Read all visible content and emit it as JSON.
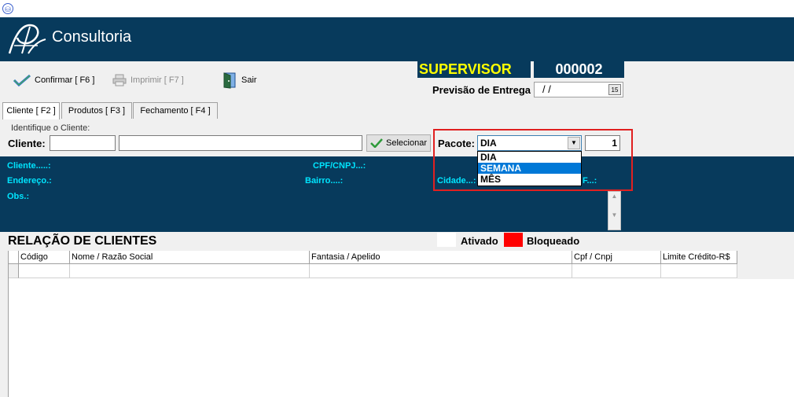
{
  "brand": {
    "name": "Consultoria"
  },
  "toolbar": {
    "confirm_label": "Confirmar [ F6 ]",
    "print_label": "Imprimir  [ F7 ]",
    "exit_label": "Sair"
  },
  "header_info": {
    "role": "SUPERVISOR",
    "code": "000002",
    "delivery_label": "Previsão de Entrega",
    "delivery_value": " /  /"
  },
  "tabs": [
    {
      "label": "Cliente [ F2 ]",
      "active": true
    },
    {
      "label": "Produtos [ F3 ]",
      "active": false
    },
    {
      "label": "Fechamento [ F4 ]",
      "active": false
    }
  ],
  "client_form": {
    "group_label": "Identifique o Cliente:",
    "client_label": "Cliente:",
    "code_value": "",
    "name_value": "",
    "select_button": "Selecionar"
  },
  "pacote": {
    "label": "Pacote:",
    "selected": "DIA",
    "options": [
      "DIA",
      "SEMANA",
      "MÊS"
    ],
    "highlighted_option": "SEMANA",
    "quantity": "1"
  },
  "info_panel": {
    "cliente_label": "Cliente.....:",
    "cpf_label": "CPF/CNPJ...:",
    "endereco_label": "Endereço.:",
    "bairro_label": "Bairro....:",
    "cidade_label": "Cidade...:",
    "uf_label": "F...:",
    "obs_label": "Obs.:"
  },
  "client_list": {
    "title": "RELAÇÃO DE CLIENTES",
    "legend_active": "Ativado",
    "legend_blocked": "Bloqueado",
    "columns": [
      "Código",
      "Nome / Razão Social",
      "Fantasia / Apelido",
      "Cpf / Cnpj",
      "Limite Crédito-R$"
    ]
  },
  "colors": {
    "header_bg": "#073a5c",
    "supervisor_text": "#ffff00",
    "info_label": "#00e5ff",
    "blocked": "#ff0000",
    "highlight_border": "#e02020"
  }
}
